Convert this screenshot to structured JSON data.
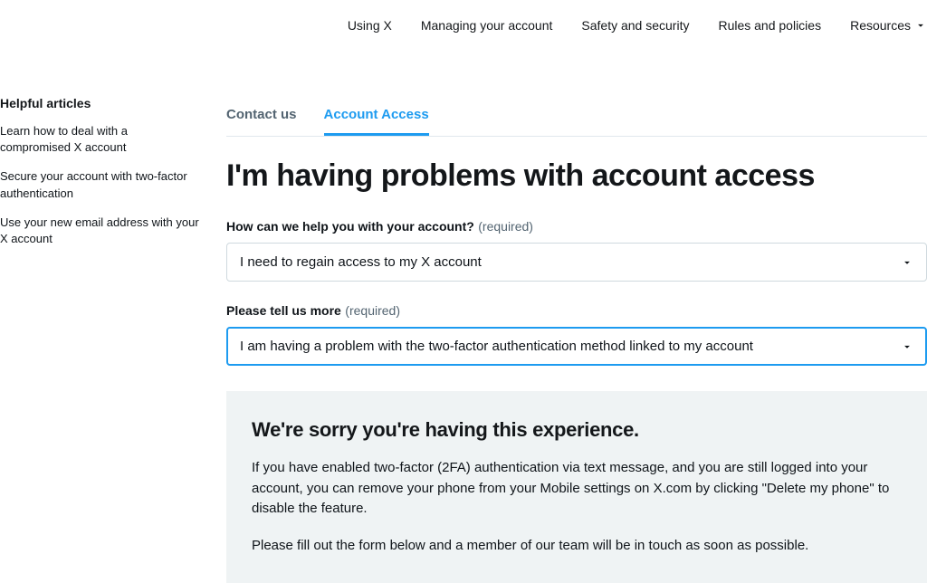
{
  "nav": {
    "items": [
      {
        "label": "Using X"
      },
      {
        "label": "Managing your account"
      },
      {
        "label": "Safety and security"
      },
      {
        "label": "Rules and policies"
      },
      {
        "label": "Resources"
      }
    ]
  },
  "sidebar": {
    "title": "Helpful articles",
    "links": [
      {
        "text": "Learn how to deal with a compromised X account"
      },
      {
        "text": "Secure your account with two-factor authentication"
      },
      {
        "text": "Use your new email address with your X account"
      }
    ]
  },
  "tabs": {
    "contact": "Contact us",
    "access": "Account Access"
  },
  "page": {
    "title": "I'm having problems with account access"
  },
  "form": {
    "q1": {
      "label": "How can we help you with your account?",
      "req": "(required)",
      "value": "I need to regain access to my X account"
    },
    "q2": {
      "label": "Please tell us more",
      "req": "(required)",
      "value": "I am having a problem with the two-factor authentication method linked to my account"
    }
  },
  "info": {
    "title": "We're sorry you're having this experience.",
    "p1": "If you have enabled two-factor (2FA) authentication via text message, and you are still logged into your account, you can remove your phone from your Mobile settings on X.com by clicking \"Delete my phone\" to disable the feature.",
    "p2": "Please fill out the form below and a member of our team will be in touch as soon as possible."
  }
}
